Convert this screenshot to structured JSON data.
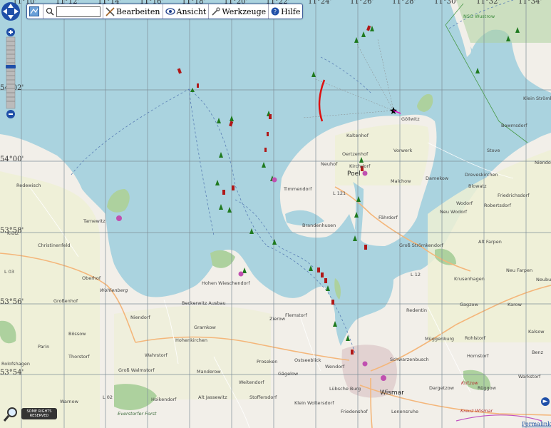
{
  "toolbar": {
    "search_placeholder": "",
    "edit_label": "Bearbeiten",
    "view_label": "Ansicht",
    "tools_label": "Werkzeuge",
    "help_label": "Hilfe"
  },
  "longitude_labels": [
    "11°10'",
    "11°12'",
    "11°14'",
    "11°16'",
    "11°18'",
    "11°20'",
    "11°22'",
    "11°24'",
    "11°26'",
    "11°28'",
    "11°30'",
    "11°32'",
    "11°34'"
  ],
  "latitude_labels": [
    "54°02'",
    "54°00'",
    "53°58'",
    "53°56'",
    "53°54'"
  ],
  "places": {
    "nsg_wustrow": "NSG Wustrow",
    "klein_stromkendorf": "Klein Strömkendorf",
    "bowmsdorf": "Bowmsdorf",
    "goehlitz": "Göllwitz",
    "kaltenhof": "Kaltenhof",
    "oertzenhof": "Oertzenhof",
    "vorwerk": "Vorwerk",
    "stove": "Stove",
    "niendorf_e": "Niendorf",
    "redewisch": "Redewisch",
    "neuhof": "Neuhof",
    "kirchdorf": "Kirchdorf",
    "poel": "Poel",
    "malchow": "Malchow",
    "damekow": "Damekow",
    "dreveskirchen": "Dreveskirchen",
    "blowatz": "Blowatz",
    "timmendorf": "Timmendorf",
    "l121": "L 121",
    "friedrichsdorf": "Friedrichsdorf",
    "wodorf": "Wodorf",
    "robertsdorf": "Robertsdorf",
    "neu_wodorf": "Neu Wodorf",
    "tarnewitz": "Tarnewitz",
    "klutz": "Klütz",
    "faehrdorf": "Fährdorf",
    "brandenhusen": "Brandenhusen",
    "christinenfeld": "Christinenfeld",
    "gross_stroemkendorf": "Groß Strömkendorf",
    "alt_farpen": "Alt Farpen",
    "l03": "L 03",
    "oberhof": "Oberhof",
    "wohlenberg": "Wohlenberg",
    "hohen_wieschendorf": "Hohen Wieschendorf",
    "l12": "L 12",
    "neu_farpen": "Neu Farpen",
    "krusenhagen": "Krusenhagen",
    "neuburg": "Neubu",
    "beckerwitz_ausbau": "Beckerwitz Ausbau",
    "grossenhof": "Großenhof",
    "niendorf_w": "Niendorf",
    "zierow": "Zierow",
    "flemstorf": "Flemstorf",
    "redentin": "Redentin",
    "gagzow": "Gagzow",
    "karow": "Karow",
    "gramkow": "Gramkow",
    "hohenkirchen": "Hohenkirchen",
    "boessow": "Bössow",
    "kalsow": "Kalsow",
    "muggenburg": "Müggenburg",
    "rohlstorf": "Rohlstorf",
    "parin": "Parin",
    "wahrstorf": "Wahrstorf",
    "thorstorf": "Thorstorf",
    "rolofshagen": "Rolofshagen",
    "ostseeblick": "Ostseeblick",
    "schwarzenbusch": "Schwarzenbusch",
    "hornstorf": "Hornstorf",
    "benz": "Benz",
    "gross_walmstorf": "Groß Walmstorf",
    "manderow": "Manderow",
    "proseken": "Proseken",
    "wendorf": "Wendorf",
    "gaegelow": "Gägelow",
    "warkstorf": "Warkstorf",
    "weitendorf": "Weitendorf",
    "dargetzow": "Dargetzow",
    "rueggow": "Rüggow",
    "luebsche_burg": "Lübsche Burg",
    "wismar": "Wismar",
    "l02": "L 02",
    "hoikendorf": "Hoikendorf",
    "alt_jassewitz": "Alt Jassewitz",
    "stoffersdorf": "Stoffersdorf",
    "klein_woltersdorf": "Klein Woltersdorf",
    "warnow": "Warnow",
    "lenensruhe": "Lenensruhe",
    "kritzow": "Kritzow",
    "friedenshof": "Friedenshof",
    "everstorfer_forst": "Everstorfer Forst",
    "kreuz_wismar": "Kreuz Wismar"
  },
  "attribution": "SOME RIGHTS RESERVED",
  "permalink": "Permalink",
  "colors": {
    "water": "#aad3df",
    "land": "#f2efe9",
    "farmland": "#eef0d5",
    "forest": "#add19e",
    "grid": "#7f8f99",
    "starboard_buoy": "#1f7a1f",
    "port_buoy": "#b01818"
  }
}
